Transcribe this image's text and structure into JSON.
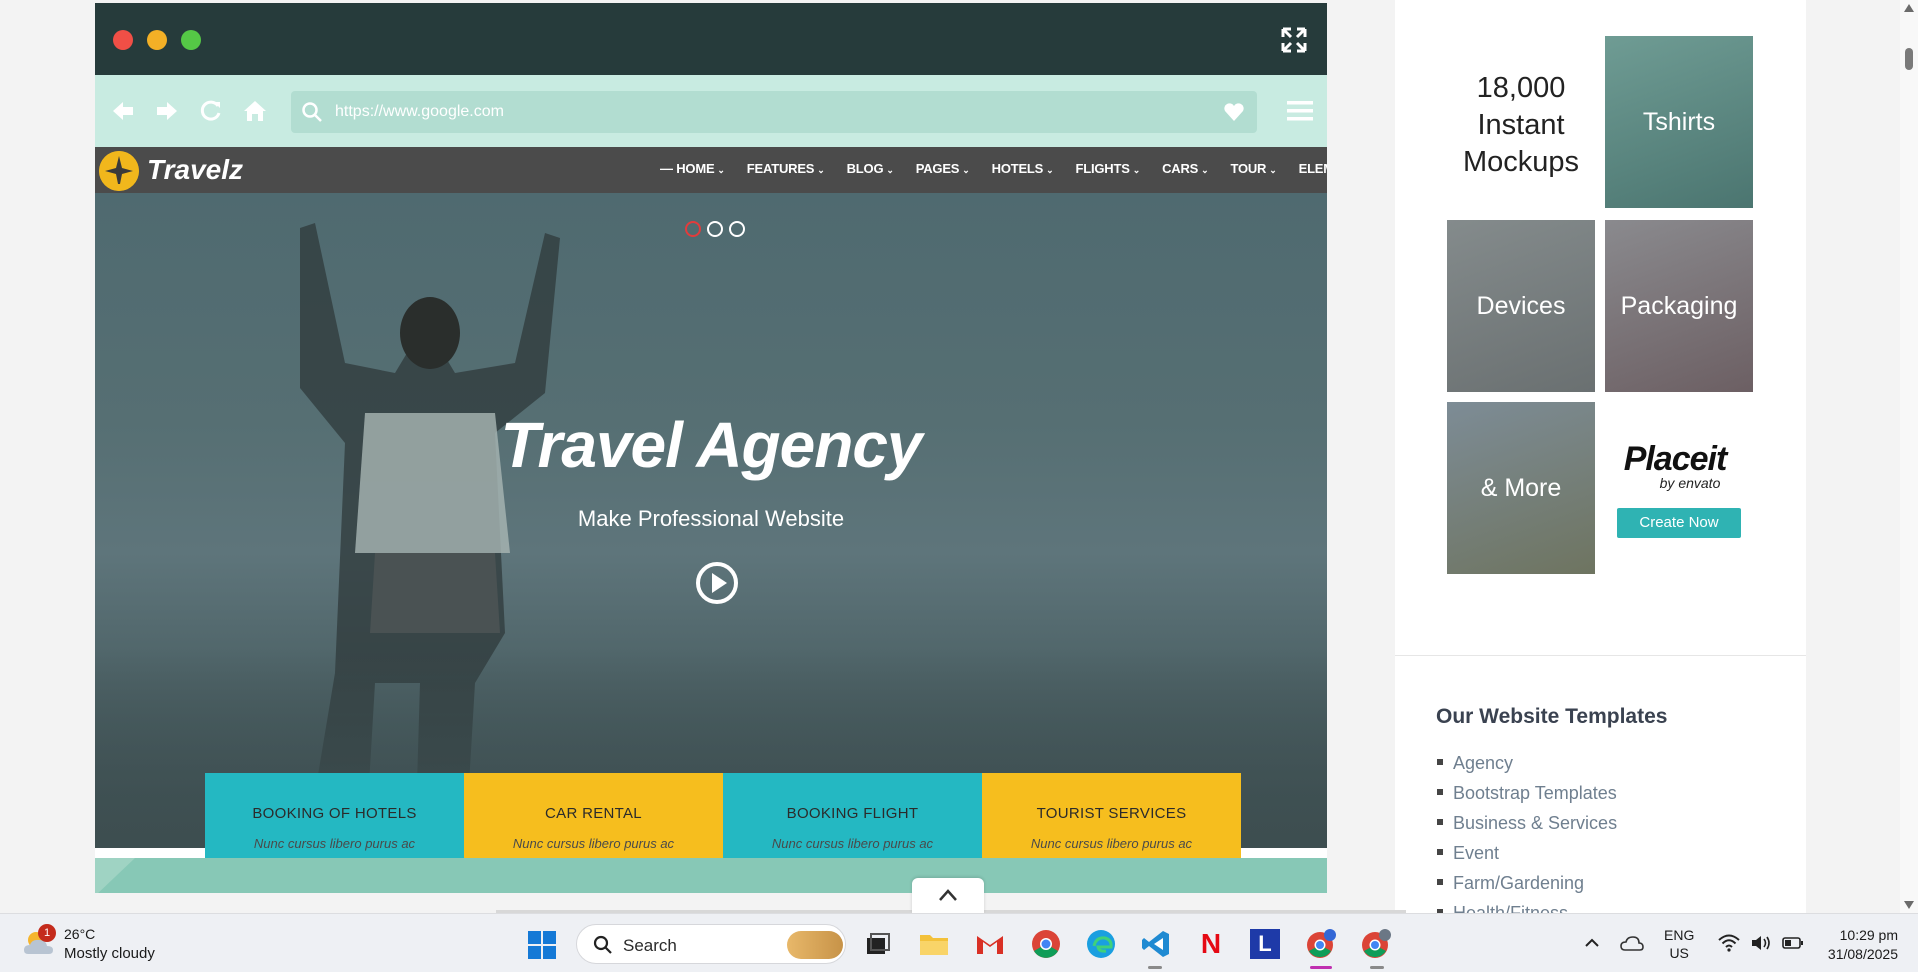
{
  "preview": {
    "address_text": "https://www.google.com",
    "brand": "Travelz",
    "nav": [
      "HOME",
      "FEATURES",
      "BLOG",
      "PAGES",
      "HOTELS",
      "FLIGHTS",
      "CARS",
      "TOUR",
      "ELEMENT"
    ],
    "hero_title": "Travel Agency",
    "hero_subtitle": "Make Professional Website",
    "slide_count": 3,
    "active_slide": 1,
    "services": [
      {
        "title": "BOOKING OF HOTELS",
        "desc": "Nunc cursus libero purus ac",
        "color": "#24b8c2"
      },
      {
        "title": "CAR RENTAL",
        "desc": "Nunc cursus libero purus ac",
        "color": "#f6be1e"
      },
      {
        "title": "BOOKING FLIGHT",
        "desc": "Nunc cursus libero purus ac",
        "color": "#24b8c2"
      },
      {
        "title": "TOURIST SERVICES",
        "desc": "Nunc cursus libero purus ac",
        "color": "#f6be1e"
      }
    ]
  },
  "ad": {
    "headline": "18,000 Instant Mockups",
    "tiles": [
      "Tshirts",
      "Devices",
      "Packaging",
      "& More"
    ],
    "brand": "Placeit",
    "brand_by": "by envato",
    "cta": "Create Now"
  },
  "sidebar": {
    "heading": "Our Website Templates",
    "items": [
      "Agency",
      "Bootstrap Templates",
      "Business & Services",
      "Event",
      "Farm/Gardening",
      "Health/Fitness"
    ]
  },
  "taskbar": {
    "weather_temp": "26°C",
    "weather_cond": "Mostly cloudy",
    "weather_badge": "1",
    "search_label": "Search",
    "lang_top": "ENG",
    "lang_bottom": "US",
    "time": "10:29 pm",
    "date": "31/08/2025"
  },
  "colors": {
    "accent_teal": "#24b8c2",
    "accent_yellow": "#f6be1e",
    "cta": "#2fb3b3"
  }
}
